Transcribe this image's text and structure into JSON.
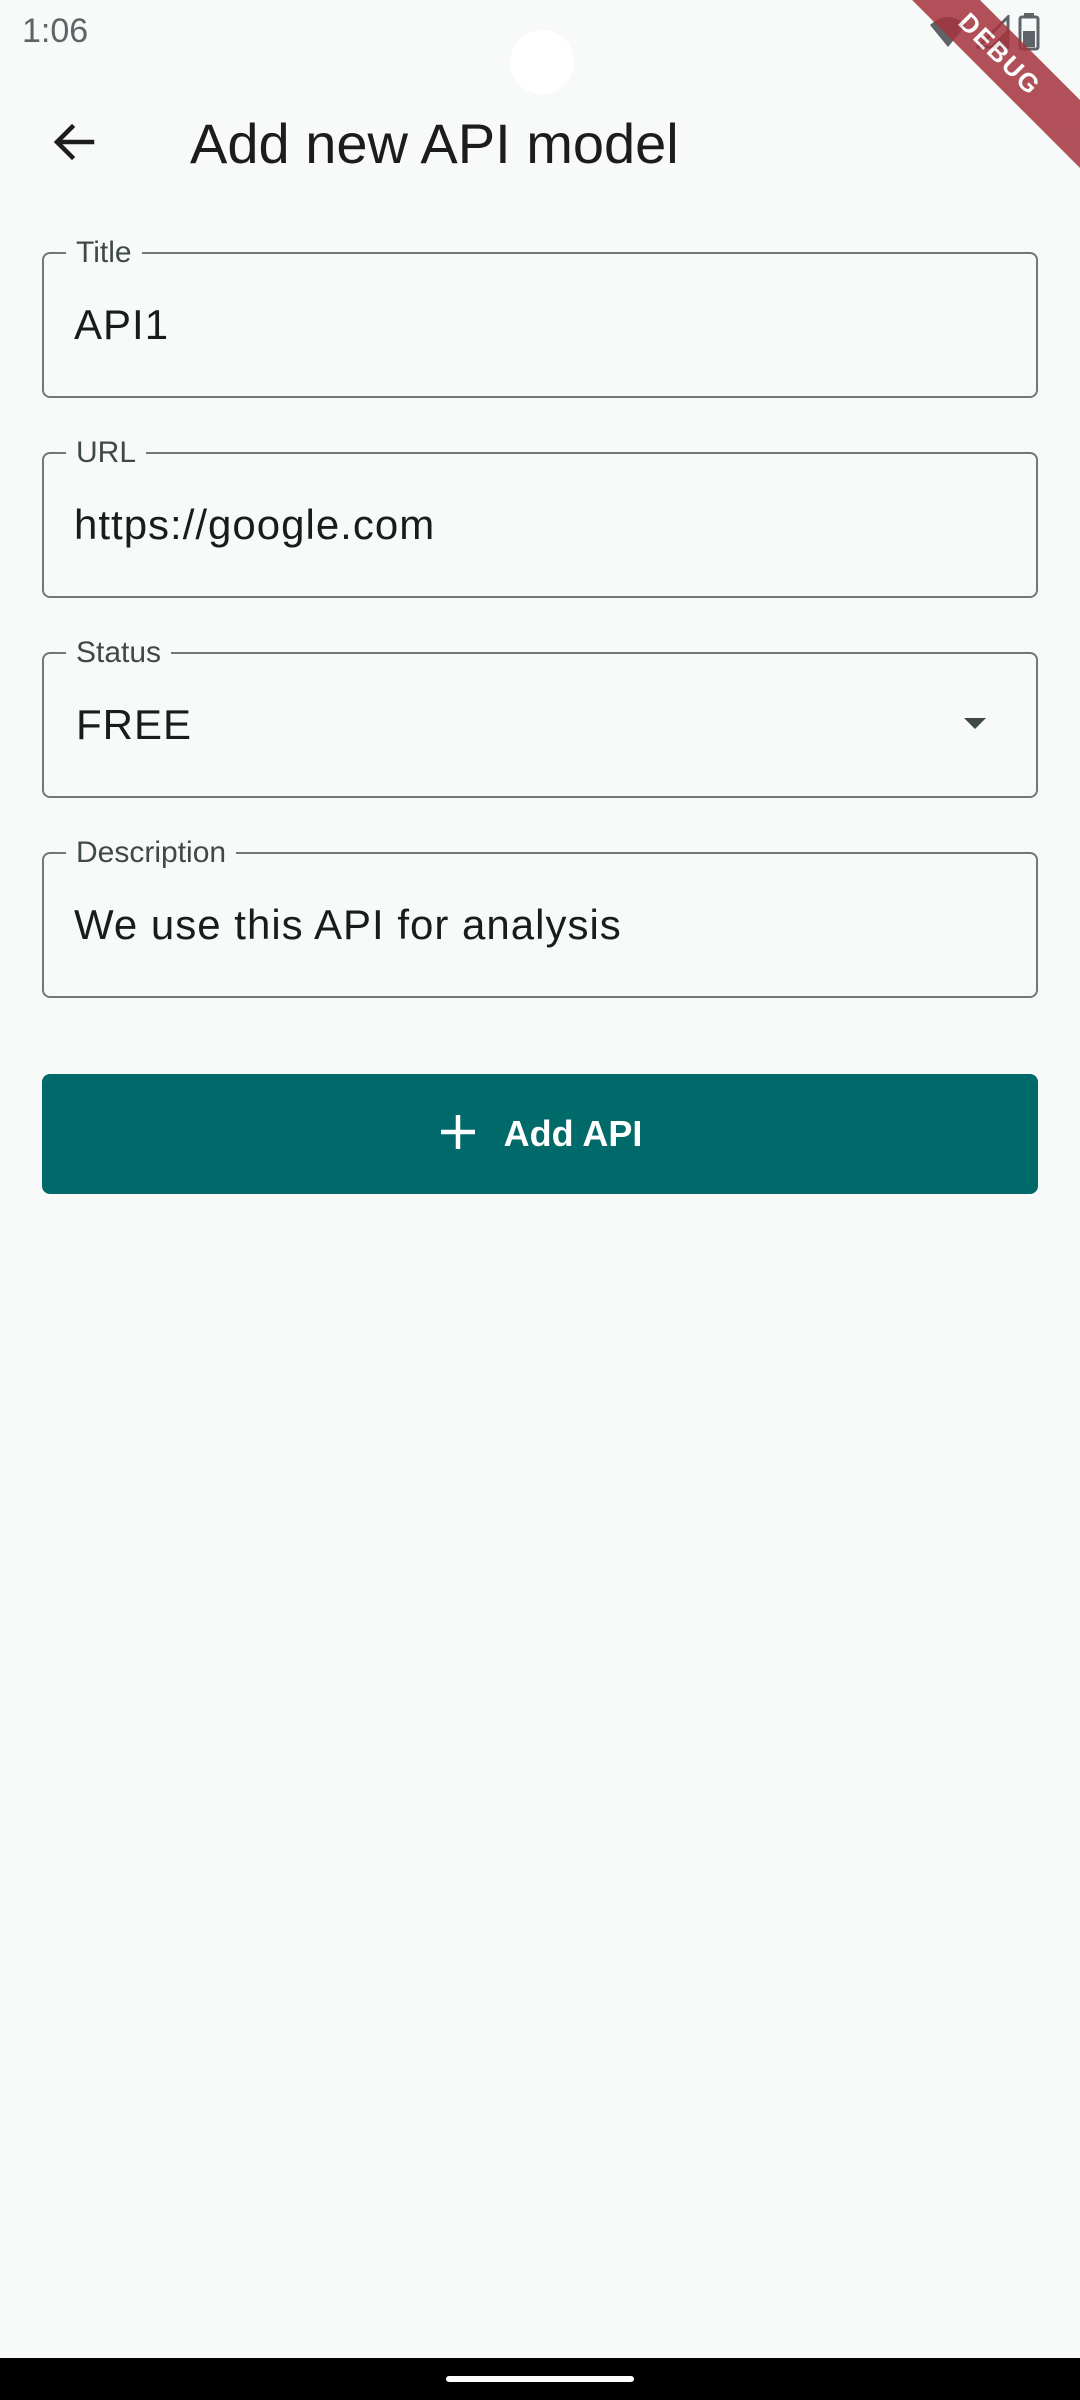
{
  "status_bar": {
    "time": "1:06",
    "icons": [
      "wifi-icon",
      "signal-icon",
      "battery-icon"
    ]
  },
  "debug_banner": "DEBUG",
  "app_bar": {
    "title": "Add new API model",
    "back_icon": "arrow-back-icon"
  },
  "form": {
    "title": {
      "label": "Title",
      "value": "API1"
    },
    "url": {
      "label": "URL",
      "value": "https://google.com"
    },
    "status": {
      "label": "Status",
      "value": "FREE"
    },
    "description": {
      "label": "Description",
      "value": "We use this API for analysis"
    }
  },
  "add_button": {
    "label": "Add API",
    "icon": "plus-icon"
  },
  "colors": {
    "background": "#f8fafa",
    "primary": "#006a6a",
    "outline": "#6f7979",
    "debug_ribbon": "#a5333c"
  }
}
